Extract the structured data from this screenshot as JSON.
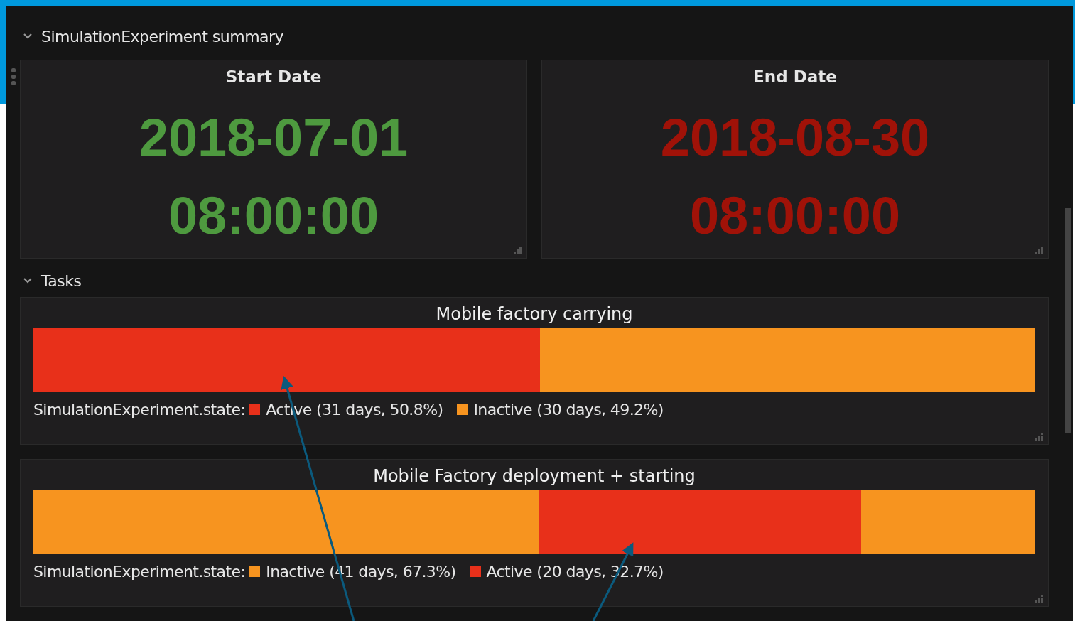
{
  "summary": {
    "title": "SimulationExperiment summary",
    "expanded": true,
    "cards": [
      {
        "label": "Start Date",
        "date": "2018-07-01",
        "time": "08:00:00",
        "color": "#4e9a3f"
      },
      {
        "label": "End Date",
        "date": "2018-08-30",
        "time": "08:00:00",
        "color": "#a01208"
      }
    ]
  },
  "tasks": {
    "title": "Tasks",
    "expanded": true,
    "items": [
      {
        "title": "Mobile factory carrying",
        "legend_label": "SimulationExperiment.state:",
        "segments": [
          {
            "color": "#e8301a"
          },
          {
            "color": "#f7941f"
          }
        ],
        "legend": [
          {
            "text": "Active (31 days, 50.8%)",
            "color": "#e8301a"
          },
          {
            "text": "Inactive (30 days, 49.2%)",
            "color": "#f7941f"
          }
        ]
      },
      {
        "title": "Mobile Factory deployment + starting",
        "legend_label": "SimulationExperiment.state:",
        "segments": [
          {
            "color": "#f7941f"
          },
          {
            "color": "#e8301a"
          },
          {
            "color": "#f7941f"
          }
        ],
        "legend": [
          {
            "text": "Inactive (41 days, 67.3%)",
            "color": "#f7941f"
          },
          {
            "text": "Active (20 days, 32.7%)",
            "color": "#e8301a"
          }
        ]
      }
    ]
  }
}
